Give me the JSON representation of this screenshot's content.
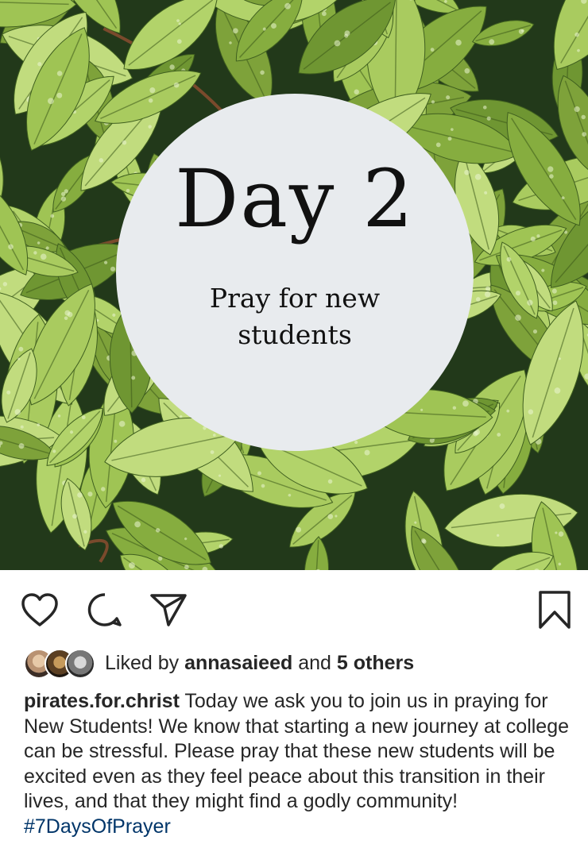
{
  "post": {
    "image": {
      "day_title": "Day 2",
      "subtitle_line1": "Pray for new",
      "subtitle_line2": "students",
      "colors": {
        "circle": "#e8ebee",
        "leaf": "#a6c85a",
        "leaf_dark": "#1e3312"
      }
    },
    "actions": {
      "like_icon": "heart-icon",
      "comment_icon": "comment-icon",
      "share_icon": "paper-plane-icon",
      "save_icon": "bookmark-icon"
    },
    "likes": {
      "prefix": "Liked by",
      "user": "annasaieed",
      "and": "and",
      "others": "5 others"
    },
    "caption": {
      "username": "pirates.for.christ",
      "text": "Today we ask you to join us in praying for New Students! We know that starting a new journey at college can be stressful. Please pray that these new students will be excited even as they feel peace about this transition in their lives, and that they might find a godly community!",
      "hashtag": "#7DaysOfPrayer",
      "hashtag_color": "#003569"
    }
  }
}
